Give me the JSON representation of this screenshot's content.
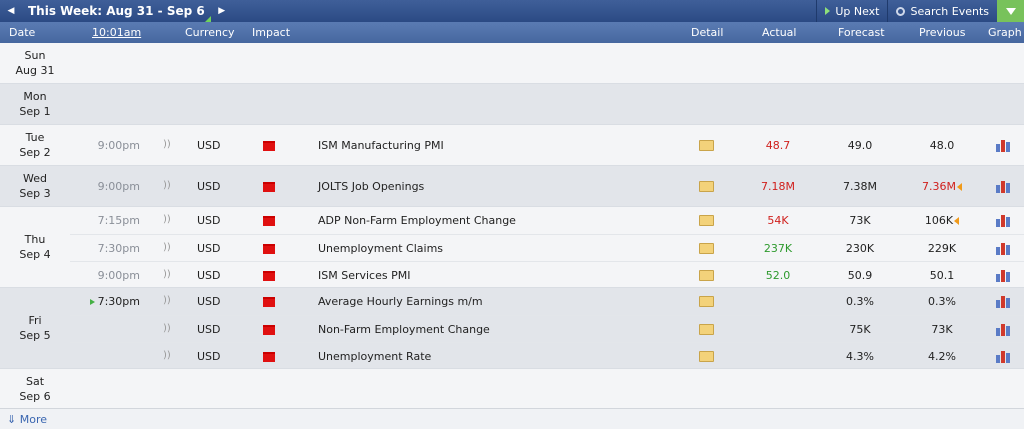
{
  "toolbar": {
    "week_label": "This Week: Aug 31 - Sep 6",
    "up_next_label": "Up Next",
    "search_label": "Search Events"
  },
  "columns": {
    "date": "Date",
    "time": "10:01am",
    "currency": "Currency",
    "impact": "Impact",
    "detail": "Detail",
    "actual": "Actual",
    "forecast": "Forecast",
    "previous": "Previous",
    "graph": "Graph"
  },
  "days": [
    {
      "day": "Sun",
      "date": "Aug 31",
      "events": []
    },
    {
      "day": "Mon",
      "date": "Sep 1",
      "events": []
    },
    {
      "day": "Tue",
      "date": "Sep 2",
      "events": [
        {
          "time": "9:00pm",
          "currency": "USD",
          "title": "ISM Manufacturing PMI",
          "actual": "48.7",
          "forecast": "49.0",
          "previous": "48.0"
        }
      ]
    },
    {
      "day": "Wed",
      "date": "Sep 3",
      "events": [
        {
          "time": "9:00pm",
          "currency": "USD",
          "title": "JOLTS Job Openings",
          "actual": "7.18M",
          "forecast": "7.38M",
          "previous": "7.36M"
        }
      ]
    },
    {
      "day": "Thu",
      "date": "Sep 4",
      "events": [
        {
          "time": "7:15pm",
          "currency": "USD",
          "title": "ADP Non-Farm Employment Change",
          "actual": "54K",
          "forecast": "73K",
          "previous": "106K"
        },
        {
          "time": "7:30pm",
          "currency": "USD",
          "title": "Unemployment Claims",
          "actual": "237K",
          "forecast": "230K",
          "previous": "229K"
        },
        {
          "time": "9:00pm",
          "currency": "USD",
          "title": "ISM Services PMI",
          "actual": "52.0",
          "forecast": "50.9",
          "previous": "50.1"
        }
      ]
    },
    {
      "day": "Fri",
      "date": "Sep 5",
      "events": [
        {
          "time": "7:30pm",
          "currency": "USD",
          "title": "Average Hourly Earnings m/m",
          "actual": "",
          "forecast": "0.3%",
          "previous": "0.3%"
        },
        {
          "time": "",
          "currency": "USD",
          "title": "Non-Farm Employment Change",
          "actual": "",
          "forecast": "75K",
          "previous": "73K"
        },
        {
          "time": "",
          "currency": "USD",
          "title": "Unemployment Rate",
          "actual": "",
          "forecast": "4.3%",
          "previous": "4.2%"
        }
      ]
    },
    {
      "day": "Sat",
      "date": "Sep 6",
      "events": []
    }
  ],
  "footer": {
    "more_label": "More"
  },
  "colors": {
    "actual_worse": "#d0201d",
    "actual_better": "#2e9a2e",
    "impact_high": "#e01010"
  }
}
